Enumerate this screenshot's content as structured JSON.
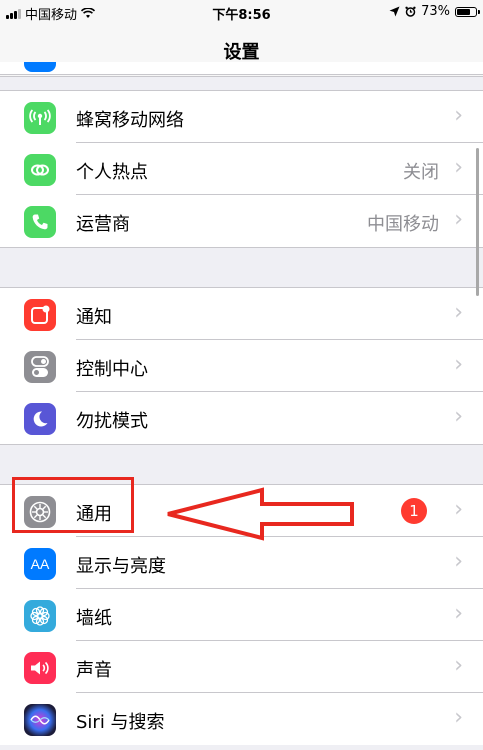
{
  "status": {
    "carrier": "中国移动",
    "time": "下午8:56",
    "battery": "73%",
    "battery_level": 0.73
  },
  "nav": {
    "title": "设置"
  },
  "groups": [
    {
      "rows": [
        {
          "label": "蜂窝移动网络",
          "value": "",
          "icon": "cellular-icon",
          "color": "#4cd964"
        },
        {
          "label": "个人热点",
          "value": "关闭",
          "icon": "hotspot-icon",
          "color": "#4cd964"
        },
        {
          "label": "运营商",
          "value": "中国移动",
          "icon": "phone-icon",
          "color": "#4cd964"
        }
      ]
    },
    {
      "rows": [
        {
          "label": "通知",
          "value": "",
          "icon": "notification-icon",
          "color": "#ff3b30"
        },
        {
          "label": "控制中心",
          "value": "",
          "icon": "control-center-icon",
          "color": "#8e8e93"
        },
        {
          "label": "勿扰模式",
          "value": "",
          "icon": "moon-icon",
          "color": "#5856d6"
        }
      ]
    },
    {
      "rows": [
        {
          "label": "通用",
          "value": "",
          "badge": "1",
          "icon": "gear-icon",
          "color": "#8e8e93"
        },
        {
          "label": "显示与亮度",
          "value": "",
          "icon": "text-size-icon",
          "color": "#007aff"
        },
        {
          "label": "墙纸",
          "value": "",
          "icon": "flower-icon",
          "color": "#34aadc"
        },
        {
          "label": "声音",
          "value": "",
          "icon": "speaker-icon",
          "color": "#ff2d55"
        },
        {
          "label": "Siri 与搜索",
          "value": "",
          "icon": "siri-icon",
          "color": "#1c1c3a"
        }
      ]
    }
  ],
  "icon_glyphs": {
    "text_size": "AA"
  },
  "annotation": {
    "color": "#e8281f"
  }
}
